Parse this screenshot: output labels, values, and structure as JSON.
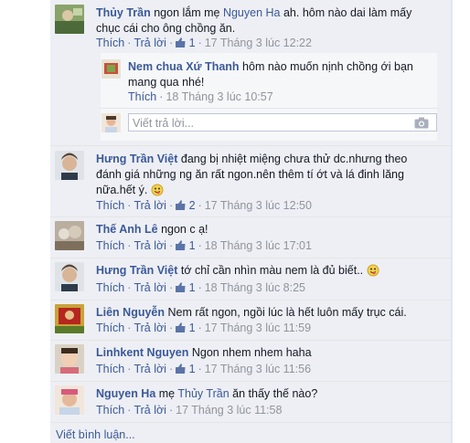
{
  "actions": {
    "like": "Thích",
    "reply": "Trả lời",
    "dot": "·"
  },
  "reply_input_placeholder": "Viết trả lời...",
  "write_comment": "Viết bình luận...",
  "comments": [
    {
      "name": "Thủy Trần",
      "text_before": " ngon lắm mẹ ",
      "mention": "Nguyen Ha",
      "text_after": " ah. hôm nào dai làm mấy chục cái cho ông chồng ăn.",
      "likes": "1",
      "time": "17 Tháng 3 lúc 12:22"
    },
    {
      "name": "Nem chua Xứ Thanh",
      "text": " hôm nào muốn nịnh chồng ới bạn mang qua nhé!",
      "time": "18 Tháng 3 lúc 10:57"
    },
    {
      "name": "Hưng Trần Việt",
      "text": " đang bị nhiệt miệng chưa thử dc.nhưng theo đánh giá những ng ăn rất ngon.nên thêm tí ớt và lá đinh lăng nữa.hết ý.",
      "likes": "2",
      "time": "17 Tháng 3 lúc 12:50"
    },
    {
      "name": "Thế Anh Lê",
      "text": " ngon c ạ!",
      "likes": "1",
      "time": "18 Tháng 3 lúc 17:01"
    },
    {
      "name": "Hưng Trần Việt",
      "text": " tớ chỉ cần nhìn màu nem là đủ biết..",
      "likes": "1",
      "time": "18 Tháng 3 lúc 8:25"
    },
    {
      "name": "Liên Nguyễn",
      "text": " Nem rất ngon, ngồi lúc là hết luôn mấy trục cái.",
      "likes": "1",
      "time": "17 Tháng 3 lúc 11:59"
    },
    {
      "name": "Linhkent Nguyen",
      "text": " Ngon nhem nhem haha",
      "likes": "1",
      "time": "17 Tháng 3 lúc 11:56"
    },
    {
      "name": "Nguyen Ha",
      "text_before": " mẹ ",
      "mention": "Thủy Trần",
      "text_after": " ăn thấy thế nào?",
      "time": "17 Tháng 3 lúc 11:58"
    }
  ]
}
